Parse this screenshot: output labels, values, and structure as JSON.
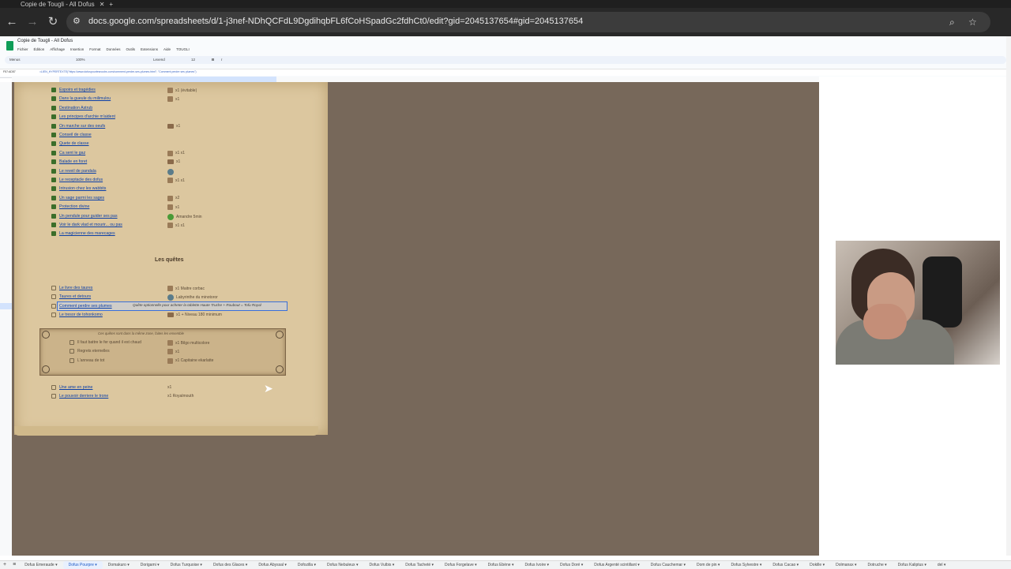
{
  "browser": {
    "tab_title": "Copie de Tougli - All Dofus",
    "url": "docs.google.com/spreadsheets/d/1-j3nef-NDhQCFdL9DgdihqbFL6fCoHSpadGc2fdhCt0/edit?gid=2045137654#gid=2045137654"
  },
  "sheets": {
    "doc_title": "Copie de Tougli - All Dofus",
    "menus": [
      "Fichier",
      "Édition",
      "Affichage",
      "Insertion",
      "Format",
      "Données",
      "Outils",
      "Extensions",
      "Aide",
      "TOUGLI"
    ],
    "toolbar": {
      "search": "Menus",
      "zoom": "100%",
      "font": "Lexend",
      "font_size": "12"
    },
    "cell_ref": "F57:AD57",
    "formula": "=LIEN_HYPERTEXTE(\"https://www.dofuspourlesnoobs.com/comment-perdre-ses-plumes.html\"; \"Comment perdre ses plumes\")"
  },
  "quests_done": [
    {
      "label": "Espoirs et tragédies",
      "reward": "x1 (évitable)",
      "icon": "feather"
    },
    {
      "label": "Dans la gueule du milimulou",
      "reward": "x1",
      "icon": "feather"
    },
    {
      "label": "Destination Astrub",
      "reward": "",
      "icon": ""
    },
    {
      "label": "Les principes d'archie m'aident",
      "reward": "",
      "icon": ""
    },
    {
      "label": "On marche sur des oeufs",
      "reward": "x1",
      "icon": "chest"
    },
    {
      "label": "Conseil de classe",
      "reward": "",
      "icon": ""
    },
    {
      "label": "Quete de classe",
      "reward": "",
      "icon": ""
    },
    {
      "label": "Ca sent le gaz",
      "reward": "x1   x1",
      "icon": "feather"
    },
    {
      "label": "Balade en foret",
      "reward": "x1",
      "icon": "chest"
    },
    {
      "label": "Le reveil de pandala",
      "reward": "",
      "icon": "tofu"
    },
    {
      "label": "Le receptacle des dofus",
      "reward": "x1   x1",
      "icon": "feather"
    },
    {
      "label": "Intrusion chez les wabbits",
      "reward": "",
      "icon": ""
    },
    {
      "label": "Un sage parmi les sages",
      "reward": "x2",
      "icon": "feather"
    },
    {
      "label": "Protection divine",
      "reward": "x1",
      "icon": "feather"
    },
    {
      "label": "Un pendule pour guider ses pas",
      "reward": "Amandre 5min",
      "icon": "green"
    },
    {
      "label": "Voir le dark vlad et mourir... ou pas",
      "reward": "x1   x1",
      "icon": "feather"
    },
    {
      "label": "La magicienne des marecages",
      "reward": "",
      "icon": ""
    }
  ],
  "section_title": "Les quêtes",
  "quests": [
    {
      "label": "Le livre des taures",
      "reward": "x1    Maitre corbac",
      "icon": "feather"
    },
    {
      "label": "Taures et detours",
      "reward": "Labyrinthe du minotoror",
      "icon": "tofu"
    },
    {
      "label": "Comment perdre ses plumes",
      "reward": "",
      "icon": ""
    },
    {
      "label": "Le tresor de tohonkomo",
      "reward": "x1     + Niveau 180 minimum",
      "icon": "chest"
    }
  ],
  "note": "Quête optionnelle pour acheter la tablette       Haute Truche + Roubout = Tofu Royal",
  "frame": {
    "title": "Ces quêtes sont dans la même zone, faites les ensemble",
    "items": [
      {
        "label": "Il faut battre le fer quand il est chaud",
        "reward": "x1     Bilgo multicolore"
      },
      {
        "label": "Regrets eternelles",
        "reward": "x1"
      },
      {
        "label": "L'anneau de tot",
        "reward": "x1     Capitaine ekarlatte"
      }
    ]
  },
  "quests_after": [
    {
      "label": "Une ame en peine",
      "reward": "x1"
    },
    {
      "label": "Le pouvoir derriere le trone",
      "reward": "x1     Royalmouth"
    }
  ],
  "sheet_tabs": [
    "Dofus Emeraude",
    "Dofus Pourpre",
    "Domakuro",
    "Dorigami",
    "Dofus Turquoise",
    "Dofus des Glaces",
    "Dofus Abyssal",
    "Dofozilla",
    "Dofus Nebuleux",
    "Dofus Vulbis",
    "Dofus Tacheté",
    "Dofus Forgelave",
    "Dofus Ebène",
    "Dofus Ivoire",
    "Dofus Doré",
    "Dofus Argenté scintillant",
    "Dofus Cauchemar",
    "Dom de pin",
    "Dofus Sylvestre",
    "Dofus Cacao",
    "Dokille",
    "Dolmanax",
    "Dotruche",
    "Dofus Kaliptus",
    "del"
  ],
  "active_tab": "Dofus Pourpre"
}
